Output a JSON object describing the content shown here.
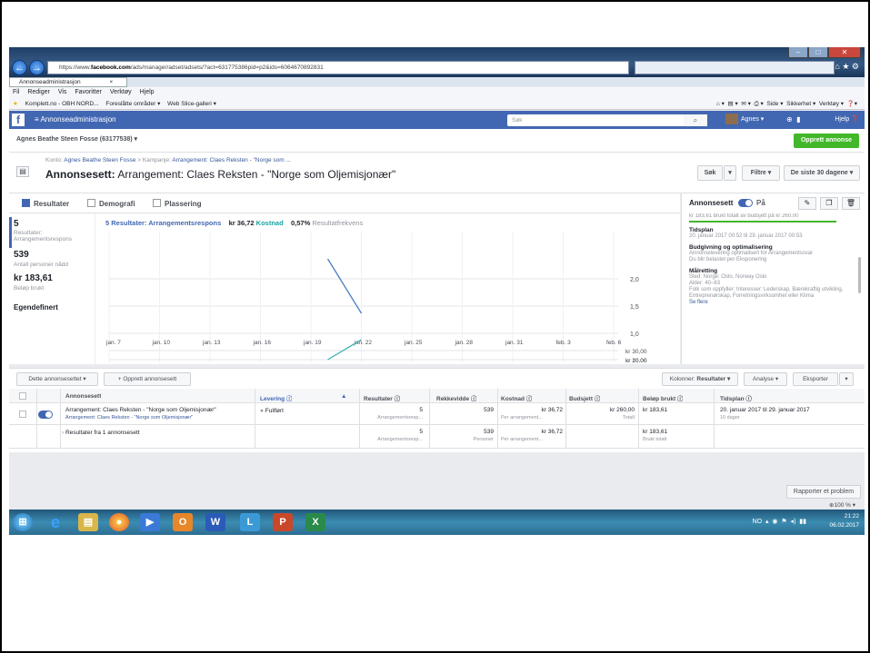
{
  "browser": {
    "url_prefix": "https://www.",
    "url_domain": "facebook.com",
    "url_rest": "/ads/manager/adset/adsets/?act=631775386pid=p2&ids=6064670892831",
    "tab_title": "Annonseadministrasjon",
    "tab_close": "×",
    "menu": [
      "Fil",
      "Rediger",
      "Vis",
      "Favoritter",
      "Verktøy",
      "Hjelp"
    ],
    "favorites": [
      "Komplett.no - OBH NORD...",
      "Foreslåtte områder ▾",
      "Web Slice-galleri ▾"
    ],
    "tools": [
      "Side ▾",
      "Sikkerhet ▾",
      "Verktøy ▾"
    ]
  },
  "fb": {
    "logo": "f",
    "menu_label": "≡  Annonseadministrasjon",
    "search_placeholder": "Søk",
    "user": "Agnes ▾",
    "help": "Hjelp"
  },
  "account": {
    "selector": "Agnes Beathe Steen Fosse (63177538) ▾",
    "create_button": "Opprett annonse"
  },
  "header": {
    "crumb_konto_label": "Konto:",
    "crumb_konto": "Agnes Beathe Steen Fosse",
    "crumb_sep": ">",
    "crumb_kampanje_label": "Kampanje:",
    "crumb_kampanje": "Arrangement: Claes Reksten - \"Norge som ...",
    "title_prefix": "Annonsesett:",
    "title": "Arrangement: Claes Reksten - \"Norge som Oljemisjonær\"",
    "btn_search": "Søk",
    "btn_arrow": "▾",
    "btn_filter": "Filtre ▾",
    "btn_date": "De siste 30 dagene ▾"
  },
  "tabs": [
    "Resultater",
    "Demografi",
    "Plassering"
  ],
  "metrics": {
    "results_value": "5",
    "results_label1": "Resultater:",
    "results_label2": "Arrangementsrespons",
    "reach_value": "539",
    "reach_label": "Antall personer nådd",
    "spent_value": "kr 183,61",
    "spent_label": "Beløp brukt",
    "custom": "Egendefinert"
  },
  "chart_header": {
    "results": "5 Resultater: Arrangementsrespons",
    "cost_value": "kr 36,72",
    "cost_label": "Kostnad",
    "rate_value": "0,57%",
    "rate_label": "Resultatfrekvens"
  },
  "chart_data": {
    "type": "line",
    "x_ticks": [
      "jan. 7",
      "jan. 10",
      "jan. 13",
      "jan. 16",
      "jan. 19",
      "jan. 22",
      "jan. 25",
      "jan. 28",
      "jan. 31",
      "feb. 3",
      "feb. 6"
    ],
    "top_y_ticks": [
      "2,0",
      "1,5",
      "1,0"
    ],
    "bottom_y_ticks": [
      "kr 30,00",
      "kr 20,00",
      "kr 10,00"
    ],
    "series": [
      {
        "values": [
          {
            "x": "jan. 20",
            "y": 2.0
          },
          {
            "x": "jan. 22",
            "y": 1.0
          }
        ],
        "color": "#4a7fc1"
      },
      {
        "values": [
          {
            "x": "jan. 20",
            "y": 10.0
          },
          {
            "x": "jan. 22",
            "y": 30.0
          }
        ],
        "color": "#3bb3b3"
      }
    ]
  },
  "panel": {
    "title": "Annonsesett",
    "state": "På",
    "budget_line": "kr 183,61 brukt totalt av budsjett på kr 260,00",
    "sched_h": "Tidsplan",
    "sched": "20. januar 2017 00:52 til 29. januar 2017 00:53",
    "bud_h": "Budgivning og optimalisering",
    "bud1": "Annonselevering optimalisert for Arrangementssvar",
    "bud2": "Du blir belastet per Eksponering",
    "tgt_h": "Målretting",
    "tgt1": "Sted: Norge: Oslo, Norway Oslo",
    "tgt2": "Alder: 40–63",
    "tgt3": "Folk som oppfyller: Interesser: Lederskap, Bærekraftig utvikling, Entreprenørskap, Forretningsvirksomhet eller Klima",
    "more": "Se flere"
  },
  "table_tools": {
    "this_adset": "Dette annonsesettet ▾",
    "create": "+ Opprett annonsesett",
    "columns_label": "Kolonner:",
    "columns_value": "Resultater ▾",
    "analysis": "Analyse ▾",
    "export": "Eksporter",
    "export_arrow": "▾"
  },
  "table": {
    "headers": [
      "Annonsesett",
      "Levering ⓘ",
      "▲",
      "Resultater ⓘ",
      "Rekkevidde ⓘ",
      "Kostnad ⓘ",
      "Budsjett ⓘ",
      "Beløp brukt ⓘ",
      "Tidsplan ⓘ"
    ],
    "row1": {
      "name": "Arrangement: Claes Reksten - \"Norge som Oljemisjonær\"",
      "sub": "Arrangement: Claes Reksten - \"Norge som Oljemisjonær\"",
      "delivery": "Fullført",
      "results": "5",
      "results_sub": "Arrangementsresp...",
      "reach": "539",
      "cost": "kr 36,72",
      "cost_sub": "Per arrangement...",
      "budget": "kr 260,00",
      "budget_sub": "Totalt",
      "spent": "kr 183,61",
      "schedule": "20. januar 2017 til 29. januar 2017",
      "schedule_sub": "10 dager"
    },
    "summary": {
      "label": "Resultater fra 1 annonsesett",
      "results": "5",
      "results_sub": "Arrangementsresp...",
      "reach": "539",
      "reach_sub": "Personer",
      "cost": "kr 36,72",
      "cost_sub": "Per arrangement...",
      "spent": "kr 183,61",
      "spent_sub": "Brukt totalt"
    }
  },
  "footer": {
    "report": "Rapporter et problem",
    "zoom": "100 % ▾"
  },
  "taskbar": {
    "time": "21:22",
    "date": "06.02.2017",
    "lang": "NO"
  }
}
